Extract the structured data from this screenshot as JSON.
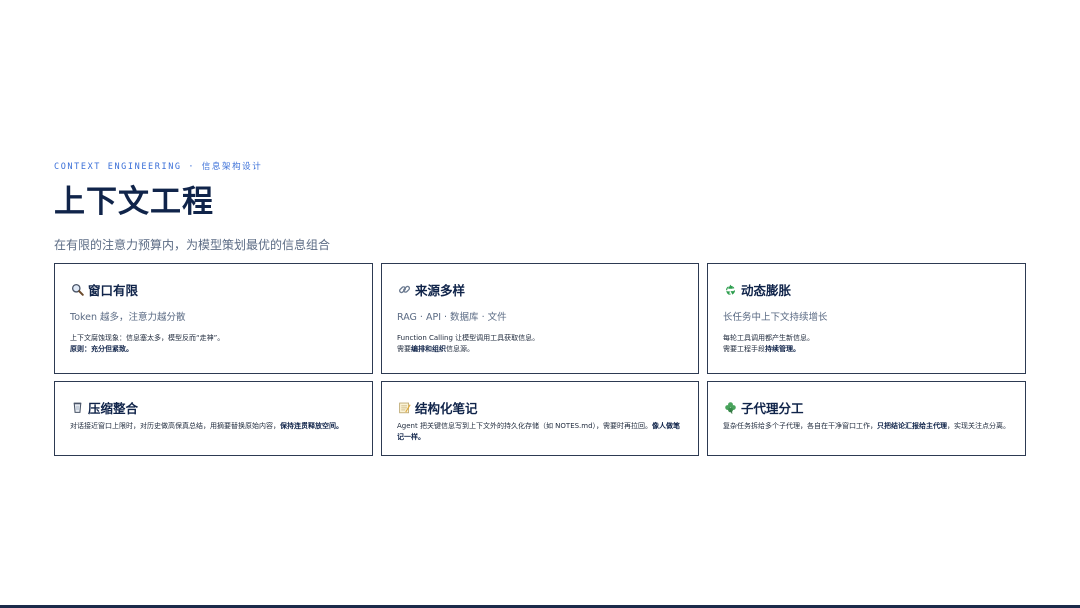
{
  "header": {
    "eyebrow": "CONTEXT ENGINEERING · 信息架构设计",
    "title": "上下文工程",
    "subtitle": "在有限的注意力预算内，为模型策划最优的信息组合"
  },
  "cards": [
    {
      "icon": "magnifier-icon",
      "title": "窗口有限",
      "subtitle": "Token 越多，注意力越分散",
      "line1": "上下文腐蚀现象：信息塞太多，模型反而“走神”。",
      "line2_prefix": "",
      "line2_bold": "原则：充分但紧致。",
      "line2_suffix": ""
    },
    {
      "icon": "link-icon",
      "title": "来源多样",
      "subtitle": "RAG · API · 数据库 · 文件",
      "line1": "Function Calling 让模型调用工具获取信息。",
      "line2_prefix": "需要",
      "line2_bold": "编排和组织",
      "line2_suffix": "信息源。"
    },
    {
      "icon": "recycle-icon",
      "title": "动态膨胀",
      "subtitle": "长任务中上下文持续增长",
      "line1": "每轮工具调用都产生新信息。",
      "line2_prefix": "需要工程手段",
      "line2_bold": "持续管理。",
      "line2_suffix": ""
    },
    {
      "icon": "cup-icon",
      "title": "压缩整合",
      "body_prefix": "对话接近窗口上限时，对历史做高保真总结，用摘要替换原始内容，",
      "body_bold": "保持连贯释放空间。",
      "body_suffix": ""
    },
    {
      "icon": "note-icon",
      "title": "结构化笔记",
      "body_prefix": "Agent 把关键信息写到上下文外的持久化存储（如 NOTES.md），需要时再拉回。",
      "body_bold": "像人做笔记一样。",
      "body_suffix": ""
    },
    {
      "icon": "clover-icon",
      "title": "子代理分工",
      "body_prefix": "复杂任务拆给多个子代理，各自在干净窗口工作，",
      "body_bold": "只把结论汇报给主代理",
      "body_suffix": "，实现关注点分离。"
    }
  ],
  "colors": {
    "accent": "#3a6fd8",
    "title": "#10244a",
    "muted": "#5b6b84",
    "border": "#2d3a52"
  }
}
